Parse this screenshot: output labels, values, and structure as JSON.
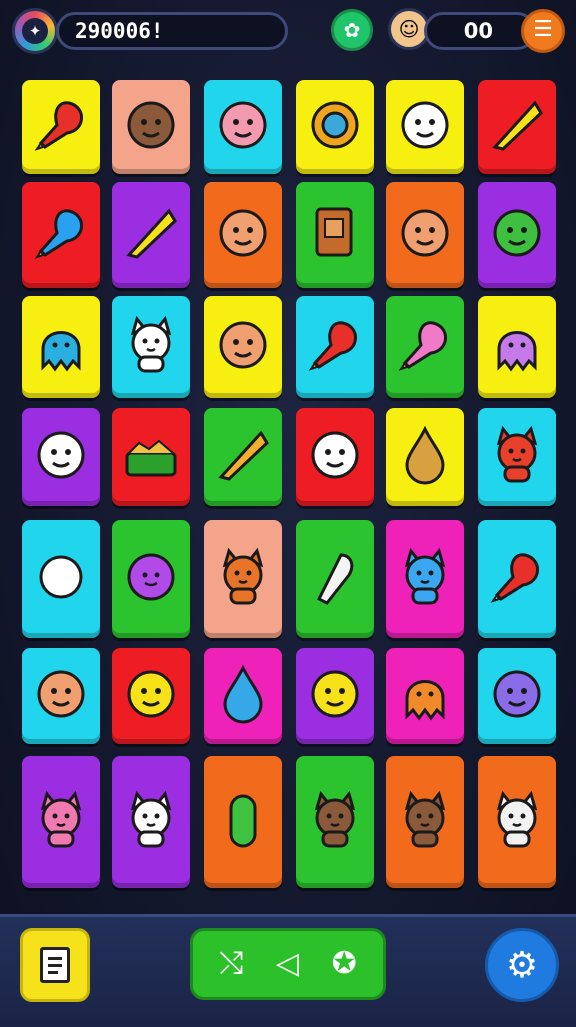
{
  "header": {
    "score": "290006!",
    "coins": "00",
    "left_avatar_icon": "bird-emblem-icon",
    "green_button_icon": "map-icon",
    "right_avatar_icon": "player-avatar-icon",
    "menu_button_label": "☰"
  },
  "board": {
    "rows": 7,
    "cols": 6,
    "tiles": [
      {
        "color": "#f6ef10",
        "icon": "drumstick-icon"
      },
      {
        "color": "#f3a48a",
        "icon": "deer-face-icon"
      },
      {
        "color": "#21d6ec",
        "icon": "pink-blob-face-icon"
      },
      {
        "color": "#f6ef10",
        "icon": "bell-icon"
      },
      {
        "color": "#f6ef10",
        "icon": "ghost-face-icon"
      },
      {
        "color": "#ee1d24",
        "icon": "broom-icon"
      },
      {
        "color": "#ee1d24",
        "icon": "blue-carrot-icon"
      },
      {
        "color": "#9a2ee0",
        "icon": "umbrella-icon"
      },
      {
        "color": "#f26b1d",
        "icon": "girl-face-icon"
      },
      {
        "color": "#2bc42f",
        "icon": "book-icon"
      },
      {
        "color": "#f26b1d",
        "icon": "boy-face-icon"
      },
      {
        "color": "#9a2ee0",
        "icon": "green-blob-icon"
      },
      {
        "color": "#f6ef10",
        "icon": "blue-ghost-icon"
      },
      {
        "color": "#21d6ec",
        "icon": "white-cat-icon"
      },
      {
        "color": "#f6ef10",
        "icon": "boy-face-icon"
      },
      {
        "color": "#21d6ec",
        "icon": "red-drumstick-icon"
      },
      {
        "color": "#2bc42f",
        "icon": "pink-drumstick-icon"
      },
      {
        "color": "#f6ef10",
        "icon": "octopus-icon"
      },
      {
        "color": "#9a2ee0",
        "icon": "white-blob-icon"
      },
      {
        "color": "#ee1d24",
        "icon": "basket-icon"
      },
      {
        "color": "#2bc42f",
        "icon": "cheese-wedge-icon"
      },
      {
        "color": "#ee1d24",
        "icon": "white-face-icon"
      },
      {
        "color": "#f6ef10",
        "icon": "drop-gear-icon"
      },
      {
        "color": "#21d6ec",
        "icon": "red-bear-icon"
      },
      {
        "color": "#21d6ec",
        "icon": "blue-girl-icon"
      },
      {
        "color": "#2bc42f",
        "icon": "purple-flower-icon"
      },
      {
        "color": "#f3a48a",
        "icon": "orange-cat-icon"
      },
      {
        "color": "#2bc42f",
        "icon": "white-tooth-icon"
      },
      {
        "color": "#ee21b8",
        "icon": "blue-cat-icon"
      },
      {
        "color": "#21d6ec",
        "icon": "red-drumstick-icon"
      },
      {
        "color": "#21d6ec",
        "icon": "red-balloon-icon"
      },
      {
        "color": "#ee1d24",
        "icon": "yellow-cat-face-icon"
      },
      {
        "color": "#ee21b8",
        "icon": "water-drop-icon"
      },
      {
        "color": "#9a2ee0",
        "icon": "yellow-cat-face-icon"
      },
      {
        "color": "#ee21b8",
        "icon": "orange-octopus-icon"
      },
      {
        "color": "#21d6ec",
        "icon": "purple-ball-face-icon"
      },
      {
        "color": "#9a2ee0",
        "icon": "pink-cat-icon"
      },
      {
        "color": "#9a2ee0",
        "icon": "white-cat-icon"
      },
      {
        "color": "#f26b1d",
        "icon": "green-pickle-icon"
      },
      {
        "color": "#2bc42f",
        "icon": "brown-bear-icon"
      },
      {
        "color": "#f26b1d",
        "icon": "brown-bear-icon"
      },
      {
        "color": "#f26b1d",
        "icon": "husky-dog-icon"
      }
    ]
  },
  "footer": {
    "list_button_icon": "document-icon",
    "center_icons": [
      "shuffle-icon",
      "sound-icon",
      "hint-icon"
    ],
    "settings_icon": "gear-icon"
  }
}
